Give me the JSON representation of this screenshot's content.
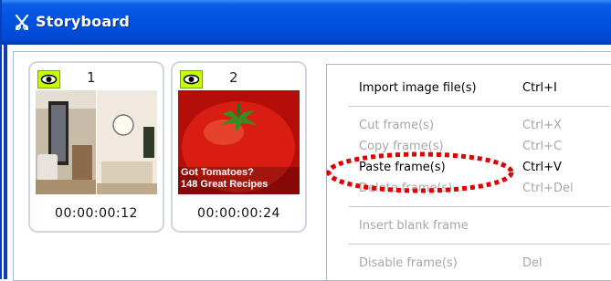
{
  "window": {
    "title": "Storyboard"
  },
  "frames": [
    {
      "number": "1",
      "timecode": "00:00:00:12"
    },
    {
      "number": "2",
      "timecode": "00:00:00:24",
      "caption_line1": "Got Tomatoes?",
      "caption_line2": "148 Great Recipes"
    }
  ],
  "context_menu": {
    "items": [
      {
        "label": "Import image file(s)",
        "shortcut": "Ctrl+I",
        "enabled": true
      },
      {
        "label": "Cut frame(s)",
        "shortcut": "Ctrl+X",
        "enabled": false
      },
      {
        "label": "Copy frame(s)",
        "shortcut": "Ctrl+C",
        "enabled": false
      },
      {
        "label": "Paste frame(s)",
        "shortcut": "Ctrl+V",
        "enabled": true
      },
      {
        "label": "Delete frame(s)",
        "shortcut": "Ctrl+Del",
        "enabled": false
      },
      {
        "label": "Insert blank frame",
        "shortcut": "",
        "enabled": false
      },
      {
        "label": "Disable frame(s)",
        "shortcut": "Del",
        "enabled": false
      }
    ]
  },
  "colors": {
    "titlebar": "#0051e0",
    "visibility_badge": "#c6ff00",
    "highlight_annotation": "#e00000"
  }
}
